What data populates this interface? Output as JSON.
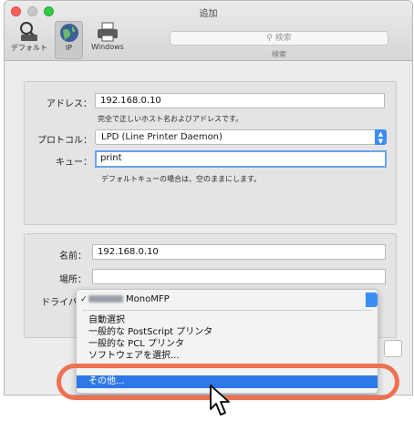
{
  "window": {
    "title": "追加"
  },
  "toolbar": {
    "items": [
      {
        "label": "デフォルト",
        "icon": "printer-magnifier-icon"
      },
      {
        "label": "IP",
        "icon": "globe-icon"
      },
      {
        "label": "Windows",
        "icon": "printer-icon"
      }
    ],
    "search": {
      "placeholder": "検索",
      "caption": "検索"
    }
  },
  "form": {
    "address": {
      "label": "アドレス：",
      "value": "192.168.0.10",
      "hint": "完全で正しいホスト名およびアドレスです。"
    },
    "protocol": {
      "label": "プロトコル：",
      "value": "LPD (Line Printer Daemon)"
    },
    "queue": {
      "label": "キュー：",
      "value": "print",
      "hint": "デフォルトキューの場合は、空のままにします。"
    },
    "name": {
      "label": "名前：",
      "value": "192.168.0.10"
    },
    "location": {
      "label": "場所：",
      "value": ""
    },
    "driver": {
      "label": "ドライバ："
    }
  },
  "driver_menu": {
    "selected": "MonoMFP",
    "items": [
      "自動選択",
      "一般的な PostScript プリンタ",
      "一般的な PCL プリンタ",
      "ソフトウェアを選択..."
    ],
    "highlighted": "その他..."
  },
  "colors": {
    "accent": "#2f78e8",
    "annotation_oval": "#ee7154"
  }
}
